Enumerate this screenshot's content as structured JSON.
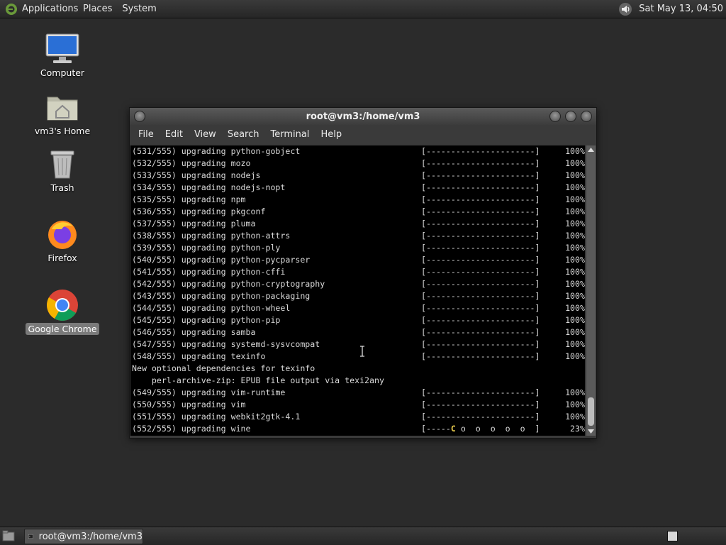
{
  "top_panel": {
    "menus": [
      "Applications",
      "Places",
      "System"
    ],
    "clock": "Sat May 13, 04:50"
  },
  "desktop_icons": [
    {
      "label": "Computer",
      "icon": "computer-icon"
    },
    {
      "label": "vm3's Home",
      "icon": "home-folder-icon"
    },
    {
      "label": "Trash",
      "icon": "trash-icon"
    },
    {
      "label": "Firefox",
      "icon": "firefox-icon"
    },
    {
      "label": "Google Chrome",
      "icon": "chrome-icon",
      "selected": true
    }
  ],
  "window": {
    "title": "root@vm3:/home/vm3",
    "menus": [
      "File",
      "Edit",
      "View",
      "Search",
      "Terminal",
      "Help"
    ]
  },
  "terminal": {
    "lines": [
      {
        "text": "(531/555) upgrading python-gobject",
        "bar": "[----------------------]",
        "pct": "100%"
      },
      {
        "text": "(532/555) upgrading mozo",
        "bar": "[----------------------]",
        "pct": "100%"
      },
      {
        "text": "(533/555) upgrading nodejs",
        "bar": "[----------------------]",
        "pct": "100%"
      },
      {
        "text": "(534/555) upgrading nodejs-nopt",
        "bar": "[----------------------]",
        "pct": "100%"
      },
      {
        "text": "(535/555) upgrading npm",
        "bar": "[----------------------]",
        "pct": "100%"
      },
      {
        "text": "(536/555) upgrading pkgconf",
        "bar": "[----------------------]",
        "pct": "100%"
      },
      {
        "text": "(537/555) upgrading pluma",
        "bar": "[----------------------]",
        "pct": "100%"
      },
      {
        "text": "(538/555) upgrading python-attrs",
        "bar": "[----------------------]",
        "pct": "100%"
      },
      {
        "text": "(539/555) upgrading python-ply",
        "bar": "[----------------------]",
        "pct": "100%"
      },
      {
        "text": "(540/555) upgrading python-pycparser",
        "bar": "[----------------------]",
        "pct": "100%"
      },
      {
        "text": "(541/555) upgrading python-cffi",
        "bar": "[----------------------]",
        "pct": "100%"
      },
      {
        "text": "(542/555) upgrading python-cryptography",
        "bar": "[----------------------]",
        "pct": "100%"
      },
      {
        "text": "(543/555) upgrading python-packaging",
        "bar": "[----------------------]",
        "pct": "100%"
      },
      {
        "text": "(544/555) upgrading python-wheel",
        "bar": "[----------------------]",
        "pct": "100%"
      },
      {
        "text": "(545/555) upgrading python-pip",
        "bar": "[----------------------]",
        "pct": "100%"
      },
      {
        "text": "(546/555) upgrading samba",
        "bar": "[----------------------]",
        "pct": "100%"
      },
      {
        "text": "(547/555) upgrading systemd-sysvcompat",
        "bar": "[----------------------]",
        "pct": "100%"
      },
      {
        "text": "(548/555) upgrading texinfo",
        "bar": "[----------------------]",
        "pct": "100%"
      },
      {
        "text": "New optional dependencies for texinfo",
        "bar": "",
        "pct": ""
      },
      {
        "text": "    perl-archive-zip: EPUB file output via texi2any",
        "bar": "",
        "pct": ""
      },
      {
        "text": "(549/555) upgrading vim-runtime",
        "bar": "[----------------------]",
        "pct": "100%"
      },
      {
        "text": "(550/555) upgrading vim",
        "bar": "[----------------------]",
        "pct": "100%"
      },
      {
        "text": "(551/555) upgrading webkit2gtk-4.1",
        "bar": "[----------------------]",
        "pct": "100%"
      },
      {
        "text": "(552/555) upgrading wine",
        "bar": "",
        "pct": "23%",
        "pacman": {
          "before": "[-----",
          "head": "C",
          "after": " o  o  o  o  o  ]"
        }
      }
    ]
  },
  "taskbar": {
    "task_label": "root@vm3:/home/vm3"
  }
}
